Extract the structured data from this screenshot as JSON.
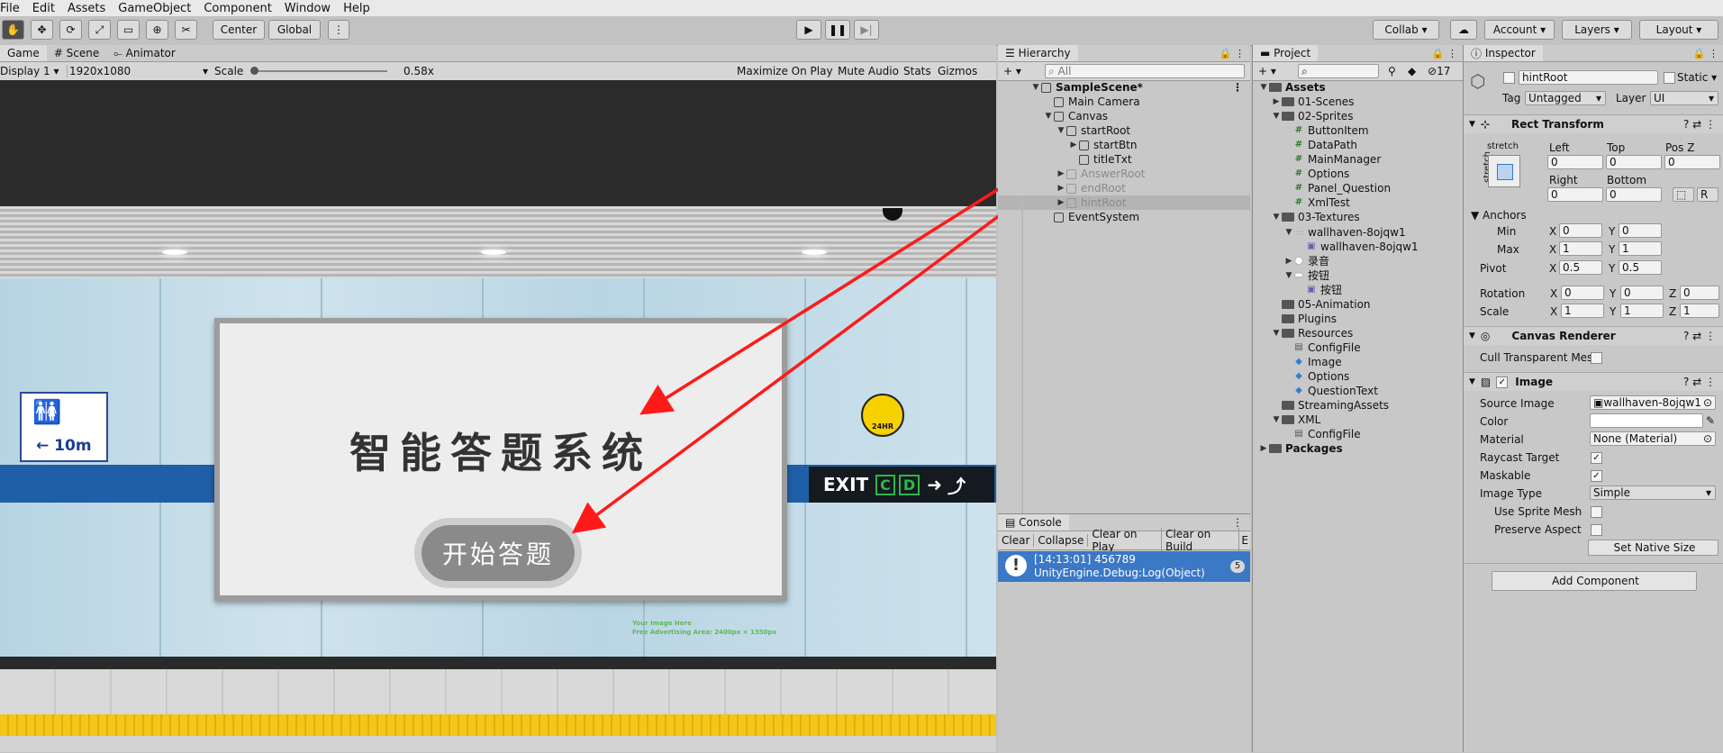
{
  "menu": [
    "File",
    "Edit",
    "Assets",
    "GameObject",
    "Component",
    "Window",
    "Help"
  ],
  "toolbar": {
    "center": "Center",
    "global": "Global",
    "collab": "Collab",
    "account": "Account",
    "layers": "Layers",
    "layout": "Layout"
  },
  "game": {
    "tabs": [
      "Game",
      "Scene",
      "Animator"
    ],
    "display": "Display 1",
    "resolution": "1920x1080",
    "scale_label": "Scale",
    "scale_value": "0.58x",
    "scale_level": 0.0,
    "maximize": "Maximize On Play",
    "mute": "Mute Audio",
    "stats": "Stats",
    "gizmos": "Gizmos",
    "scene": {
      "title": "智能答题系统",
      "button": "开始答题",
      "sign_dist": "10m",
      "exit": "EXIT",
      "exit_c": "C",
      "exit_d": "D",
      "cam_label": "24HR",
      "ad_line1": "Your Image Here",
      "ad_line2": "Free Advertising Area: 2400px × 1350px"
    }
  },
  "hierarchy": {
    "title": "Hierarchy",
    "search": "All",
    "items": [
      {
        "label": "SampleScene*",
        "indent": 0
      },
      {
        "label": "Main Camera",
        "indent": 1
      },
      {
        "label": "Canvas",
        "indent": 1
      },
      {
        "label": "startRoot",
        "indent": 2
      },
      {
        "label": "startBtn",
        "indent": 3
      },
      {
        "label": "titleTxt",
        "indent": 3
      },
      {
        "label": "AnswerRoot",
        "indent": 2
      },
      {
        "label": "endRoot",
        "indent": 2
      },
      {
        "label": "hintRoot",
        "indent": 2
      },
      {
        "label": "EventSystem",
        "indent": 1
      }
    ]
  },
  "project": {
    "title": "Project",
    "count": "17",
    "items": [
      {
        "label": "Assets"
      },
      {
        "label": "01-Scenes"
      },
      {
        "label": "02-Sprites"
      },
      {
        "label": "ButtonItem"
      },
      {
        "label": "DataPath"
      },
      {
        "label": "MainManager"
      },
      {
        "label": "Options"
      },
      {
        "label": "Panel_Question"
      },
      {
        "label": "XmlTest"
      },
      {
        "label": "03-Textures"
      },
      {
        "label": "wallhaven-8ojqw1"
      },
      {
        "label": "wallhaven-8ojqw1"
      },
      {
        "label": "录音"
      },
      {
        "label": "按钮"
      },
      {
        "label": "按钮"
      },
      {
        "label": "05-Animation"
      },
      {
        "label": "Plugins"
      },
      {
        "label": "Resources"
      },
      {
        "label": "ConfigFile"
      },
      {
        "label": "Image"
      },
      {
        "label": "Options"
      },
      {
        "label": "QuestionText"
      },
      {
        "label": "StreamingAssets"
      },
      {
        "label": "XML"
      },
      {
        "label": "ConfigFile"
      },
      {
        "label": "Packages"
      }
    ]
  },
  "inspector": {
    "title": "Inspector",
    "name": "hintRoot",
    "static": "Static",
    "tag_label": "Tag",
    "tag": "Untagged",
    "layer_label": "Layer",
    "layer": "UI",
    "rect": {
      "title": "Rect Transform",
      "stretch": "stretch",
      "left_l": "Left",
      "top_l": "Top",
      "posz_l": "Pos Z",
      "left": "0",
      "top": "0",
      "posz": "0",
      "right_l": "Right",
      "bottom_l": "Bottom",
      "right": "0",
      "bottom": "0",
      "r_btn": "R",
      "anchors": "Anchors",
      "min": "Min",
      "max": "Max",
      "min_x": "0",
      "min_y": "0",
      "max_x": "1",
      "max_y": "1",
      "pivot": "Pivot",
      "pivot_x": "0.5",
      "pivot_y": "0.5",
      "rotation": "Rotation",
      "rot_x": "0",
      "rot_y": "0",
      "rot_z": "0",
      "scale": "Scale",
      "sc_x": "1",
      "sc_y": "1",
      "sc_z": "1",
      "x": "X",
      "y": "Y",
      "z": "Z"
    },
    "canvas_renderer": {
      "title": "Canvas Renderer",
      "cull": "Cull Transparent Mes"
    },
    "image": {
      "title": "Image",
      "source_label": "Source Image",
      "source": "wallhaven-8ojqw1",
      "color_label": "Color",
      "material_label": "Material",
      "material": "None (Material)",
      "raycast": "Raycast Target",
      "maskable": "Maskable",
      "type_label": "Image Type",
      "type": "Simple",
      "use_sprite": "Use Sprite Mesh",
      "preserve": "Preserve Aspect",
      "native": "Set Native Size"
    },
    "add_component": "Add Component"
  },
  "console": {
    "title": "Console",
    "buttons": [
      "Clear",
      "Collapse",
      "Clear on Play",
      "Clear on Build",
      "E"
    ],
    "log_time": "[14:13:01] 456789",
    "log_src": "UnityEngine.Debug:Log(Object)",
    "log_count": "5"
  },
  "colors": {
    "accent": "#3b78c6",
    "arrow": "#ff1a1a",
    "blue_band": "#1f5fa8",
    "floor_yellow": "#f3c61a"
  }
}
